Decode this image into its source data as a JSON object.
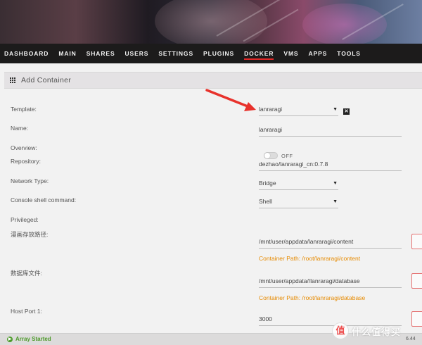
{
  "nav": {
    "items": [
      "DASHBOARD",
      "MAIN",
      "SHARES",
      "USERS",
      "SETTINGS",
      "PLUGINS",
      "DOCKER",
      "VMS",
      "APPS",
      "TOOLS"
    ],
    "active": "DOCKER"
  },
  "section": {
    "title": "Add Container"
  },
  "form": {
    "template_label": "Template:",
    "template_value": "lanraragi",
    "name_label": "Name:",
    "name_value": "lanraragi",
    "overview_label": "Overview:",
    "repository_label": "Repository:",
    "repository_value": "dezhao/lanraragi_cn:0.7.8",
    "network_label": "Network Type:",
    "network_value": "Bridge",
    "console_label": "Console shell command:",
    "console_value": "Shell",
    "privileged_label": "Privileged:",
    "privileged_state": "OFF",
    "path1_label": "漫画存放路径:",
    "path1_value": "/mnt/user/appdata/lanraragi/content",
    "path1_container": "Container Path: /root/lanraragi/content",
    "path2_label": "数据库文件:",
    "path2_value": "/mnt/user/appdata//lanraragi/database",
    "path2_container": "Container Path: /root/lanraragi/database",
    "port_label": "Host Port 1:",
    "port_value": "3000"
  },
  "footer": {
    "status": "Array Started",
    "version": "6.44"
  },
  "watermark": {
    "logo": "值",
    "text": "什么值得买"
  },
  "colors": {
    "accent_red": "#e22828",
    "container_path": "#e68a00",
    "status_green": "#4c9a2a",
    "nav_bg": "#1c1b1b"
  }
}
